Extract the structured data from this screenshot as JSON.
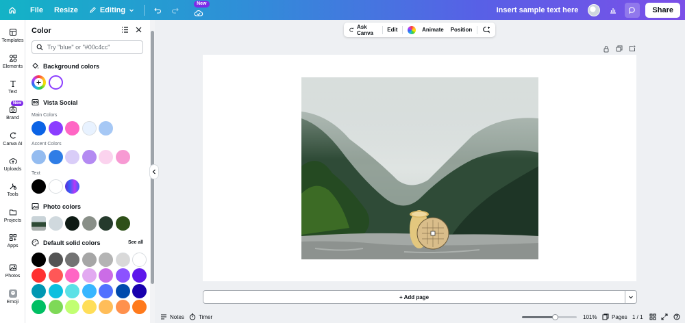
{
  "topbar": {
    "file_label": "File",
    "resize_label": "Resize",
    "editing_label": "Editing",
    "new_badge": "New",
    "sample_text_label": "Insert sample text here",
    "share_label": "Share"
  },
  "rail": {
    "items": [
      {
        "label": "Templates",
        "icon": "templates-icon"
      },
      {
        "label": "Elements",
        "icon": "elements-icon"
      },
      {
        "label": "Text",
        "icon": "text-icon"
      },
      {
        "label": "Brand",
        "icon": "brand-icon",
        "badge": "New"
      },
      {
        "label": "Canva AI",
        "icon": "canva-ai-icon"
      },
      {
        "label": "Uploads",
        "icon": "upload-icon"
      },
      {
        "label": "Tools",
        "icon": "tools-icon"
      },
      {
        "label": "Projects",
        "icon": "folder-icon"
      },
      {
        "label": "Apps",
        "icon": "apps-icon"
      },
      {
        "label": "Photos",
        "icon": "photos-icon"
      },
      {
        "label": "Emoji",
        "icon": "emoji-icon"
      }
    ]
  },
  "panel": {
    "title": "Color",
    "search_placeholder": "Try \"blue\" or \"#00c4cc\"",
    "background_colors": {
      "heading": "Background colors",
      "selected": "#ffffff"
    },
    "brand_kit": {
      "heading": "Vista Social",
      "main_label": "Main Colors",
      "main_colors": [
        "#0b63e5",
        "#8b3dff",
        "#ff66c4",
        "#e8f2ff",
        "#a6c8f5"
      ],
      "accent_label": "Accent Colors",
      "accent_colors": [
        "#94bcf0",
        "#2f7de6",
        "#d9cdf8",
        "#b48af2",
        "#fbd3ee",
        "#f79ad3"
      ],
      "text_label": "Text",
      "text_colors": [
        "#000000",
        "#ffffff",
        "gradient-purple-blue"
      ]
    },
    "photo_colors": {
      "heading": "Photo colors",
      "colors": [
        "#d0d9de",
        "#0e1a14",
        "#898f88",
        "#253a2c",
        "#2e5018"
      ]
    },
    "default_colors": {
      "heading": "Default solid colors",
      "see_all": "See all",
      "rows": [
        [
          "#000000",
          "#545454",
          "#737373",
          "#a6a6a6",
          "#b4b4b4",
          "#d9d9d9",
          "#ffffff"
        ],
        [
          "#ff3131",
          "#ff5757",
          "#ff66c4",
          "#e2a9f1",
          "#cb6ce6",
          "#8c52ff",
          "#5e17eb"
        ],
        [
          "#0097b2",
          "#0cc0df",
          "#5ce1e6",
          "#38b6ff",
          "#5271ff",
          "#004aad",
          "#1800ad"
        ],
        [
          "#00bf63",
          "#7ed957",
          "#c1ff72",
          "#ffde59",
          "#ffbd59",
          "#ff914d",
          "#ff7a1c"
        ]
      ]
    }
  },
  "context_toolbar": {
    "ask_canva": "Ask Canva",
    "edit": "Edit",
    "animate": "Animate",
    "position": "Position"
  },
  "canvas": {
    "add_page_label": "+ Add page"
  },
  "bottombar": {
    "notes_label": "Notes",
    "timer_label": "Timer",
    "zoom_label": "101%",
    "zoom_fraction": 0.6,
    "pages_label": "Pages",
    "page_count": "1 / 1"
  },
  "colors": {
    "brand_purple": "#7d2ae8",
    "gradient_start": "#13b3c6",
    "gradient_end": "#7b4fe8"
  }
}
